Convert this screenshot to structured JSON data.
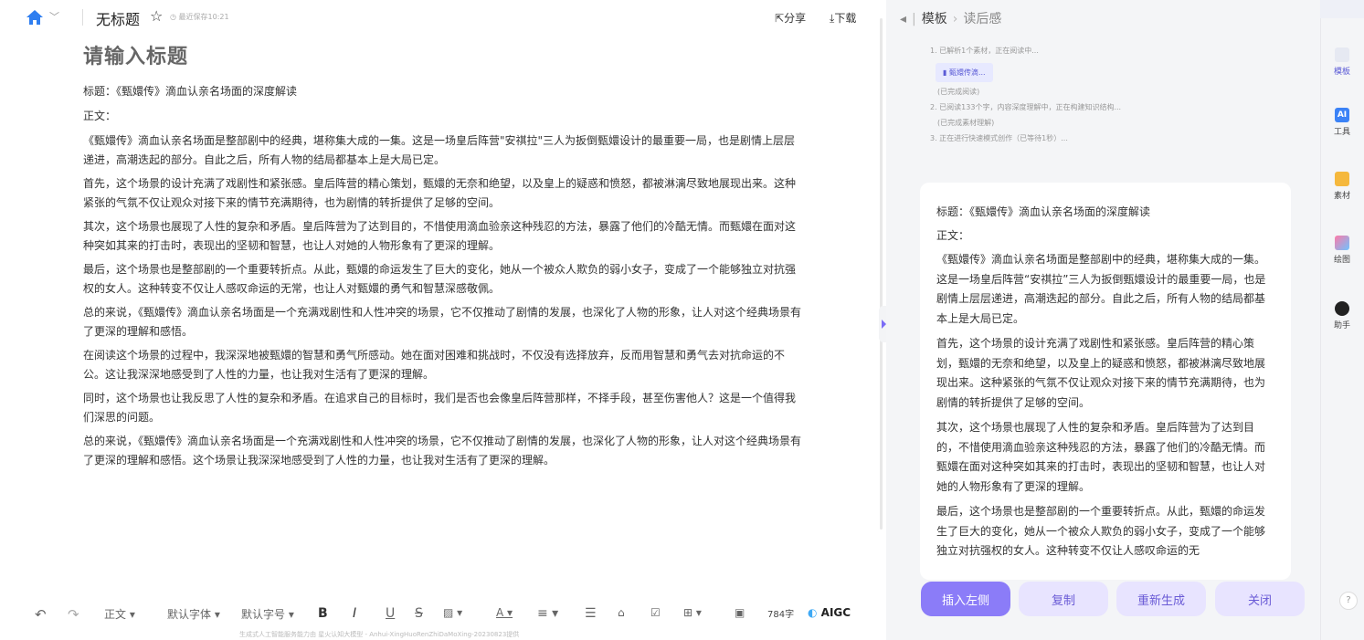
{
  "header": {
    "doc_title": "无标题",
    "saved_status": "最近保存10:21",
    "share_label": "分享",
    "download_label": "下载"
  },
  "editor": {
    "placeholder_title": "请输入标题",
    "title_line": "标题：《甄嬛传》滴血认亲名场面的深度解读",
    "body_label": "正文：",
    "paragraphs": [
      "《甄嬛传》滴血认亲名场面是整部剧中的经典，堪称集大成的一集。这是一场皇后阵营\"安祺拉\"三人为扳倒甄嬛设计的最重要一局，也是剧情上层层递进，高潮迭起的部分。自此之后，所有人物的结局都基本上是大局已定。",
      "首先，这个场景的设计充满了戏剧性和紧张感。皇后阵营的精心策划，甄嬛的无奈和绝望，以及皇上的疑惑和愤怒，都被淋漓尽致地展现出来。这种紧张的气氛不仅让观众对接下来的情节充满期待，也为剧情的转折提供了足够的空间。",
      "其次，这个场景也展现了人性的复杂和矛盾。皇后阵营为了达到目的，不惜使用滴血验亲这种残忍的方法，暴露了他们的冷酷无情。而甄嬛在面对这种突如其来的打击时，表现出的坚韧和智慧，也让人对她的人物形象有了更深的理解。",
      "最后，这个场景也是整部剧的一个重要转折点。从此，甄嬛的命运发生了巨大的变化，她从一个被众人欺负的弱小女子，变成了一个能够独立对抗强权的女人。这种转变不仅让人感叹命运的无常，也让人对甄嬛的勇气和智慧深感敬佩。",
      "总的来说，《甄嬛传》滴血认亲名场面是一个充满戏剧性和人性冲突的场景，它不仅推动了剧情的发展，也深化了人物的形象，让人对这个经典场景有了更深的理解和感悟。",
      "在阅读这个场景的过程中，我深深地被甄嬛的智慧和勇气所感动。她在面对困难和挑战时，不仅没有选择放弃，反而用智慧和勇气去对抗命运的不公。这让我深深地感受到了人性的力量，也让我对生活有了更深的理解。",
      "同时，这个场景也让我反思了人性的复杂和矛盾。在追求自己的目标时，我们是否也会像皇后阵营那样，不择手段，甚至伤害他人？这是一个值得我们深思的问题。",
      "总的来说，《甄嬛传》滴血认亲名场面是一个充满戏剧性和人性冲突的场景，它不仅推动了剧情的发展，也深化了人物的形象，让人对这个经典场景有了更深的理解和感悟。这个场景让我深深地感受到了人性的力量，也让我对生活有了更深的理解。"
    ]
  },
  "toolbar": {
    "style": "正文",
    "font": "默认字体",
    "size": "默认字号",
    "bold": "B",
    "italic": "I",
    "underline": "U",
    "strike": "S",
    "word_count": "784字",
    "aigc": "AIGC",
    "footnote": "生成式人工智能服务能力由 星火认知大模型 - Anhui-XingHuoRenZhiDaMoXing-20230823提供"
  },
  "panel": {
    "crumb_root": "模板",
    "crumb_sub": "读后感",
    "steps": [
      "1. 已解析1个素材，正在阅读中...",
      "(已完成阅读)",
      "2. 已阅读133个字，内容深度理解中，正在构建知识结构...",
      "(已完成素材理解)",
      "3. 正在进行快速模式创作（已等待1秒）..."
    ],
    "file_chip": "甄嬛传滴...",
    "card": {
      "title_line": "标题：《甄嬛传》滴血认亲名场面的深度解读",
      "body_label": "正文：",
      "paragraphs": [
        "《甄嬛传》滴血认亲名场面是整部剧中的经典，堪称集大成的一集。这是一场皇后阵营“安祺拉”三人为扳倒甄嬛设计的最重要一局，也是剧情上层层递进，高潮迭起的部分。自此之后，所有人物的结局都基本上是大局已定。",
        "首先，这个场景的设计充满了戏剧性和紧张感。皇后阵营的精心策划，甄嬛的无奈和绝望，以及皇上的疑惑和愤怒，都被淋漓尽致地展现出来。这种紧张的气氛不仅让观众对接下来的情节充满期待，也为剧情的转折提供了足够的空间。",
        "其次，这个场景也展现了人性的复杂和矛盾。皇后阵营为了达到目的，不惜使用滴血验亲这种残忍的方法，暴露了他们的冷酷无情。而甄嬛在面对这种突如其来的打击时，表现出的坚韧和智慧，也让人对她的人物形象有了更深的理解。",
        "最后，这个场景也是整部剧的一个重要转折点。从此，甄嬛的命运发生了巨大的变化，她从一个被众人欺负的弱小女子，变成了一个能够独立对抗强权的女人。这种转变不仅让人感叹命运的无"
      ]
    },
    "buttons": {
      "insert_left": "插入左侧",
      "copy": "复制",
      "regenerate": "重新生成",
      "close": "关闭"
    }
  },
  "rail": {
    "items": [
      "模板",
      "工具",
      "素材",
      "绘图",
      "助手"
    ],
    "ai_badge": "AI",
    "help": "?"
  },
  "colors": {
    "accent": "#8b7cf8",
    "accent_light": "#e8e4ff",
    "home_blue": "#2f7ef0"
  }
}
